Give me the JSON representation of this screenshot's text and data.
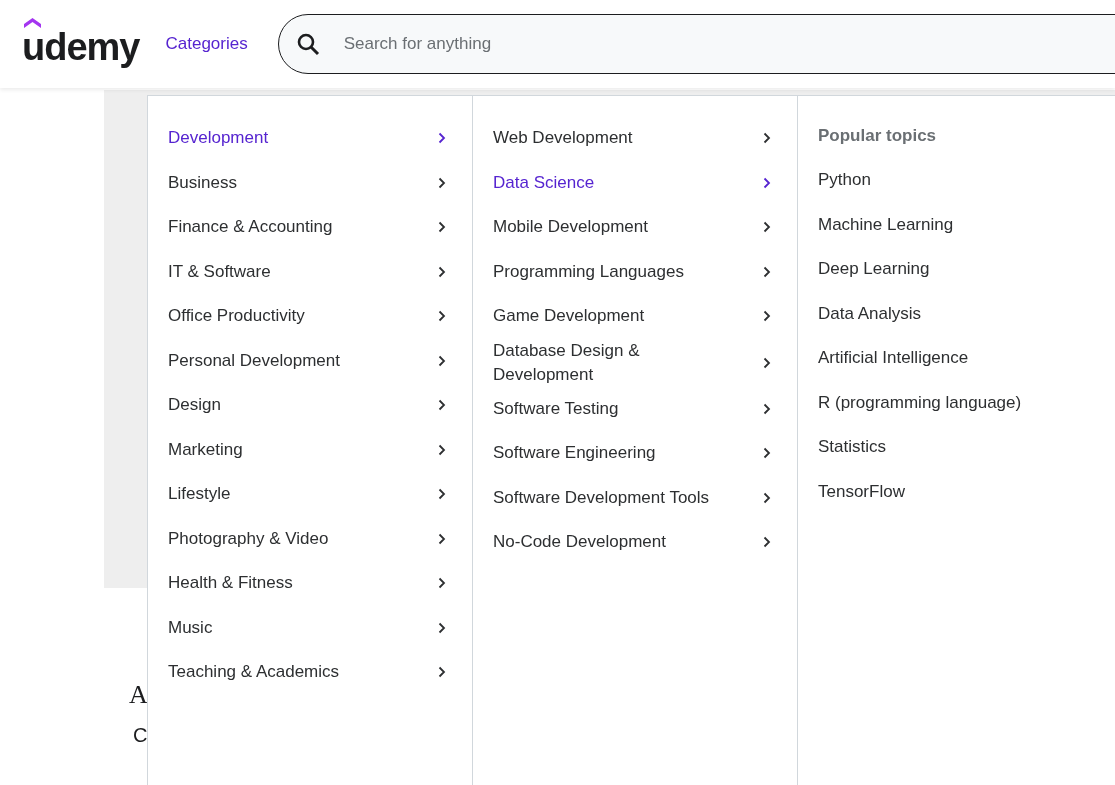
{
  "header": {
    "logo": "udemy",
    "categories_link": "Categories",
    "search": {
      "placeholder": "Search for anything"
    }
  },
  "page": {
    "heading": "A",
    "subheading": "C"
  },
  "menu": {
    "categories": [
      {
        "label": "Development",
        "selected": true
      },
      {
        "label": "Business",
        "selected": false
      },
      {
        "label": "Finance & Accounting",
        "selected": false
      },
      {
        "label": "IT & Software",
        "selected": false
      },
      {
        "label": "Office Productivity",
        "selected": false
      },
      {
        "label": "Personal Development",
        "selected": false
      },
      {
        "label": "Design",
        "selected": false
      },
      {
        "label": "Marketing",
        "selected": false
      },
      {
        "label": "Lifestyle",
        "selected": false
      },
      {
        "label": "Photography & Video",
        "selected": false
      },
      {
        "label": "Health & Fitness",
        "selected": false
      },
      {
        "label": "Music",
        "selected": false
      },
      {
        "label": "Teaching & Academics",
        "selected": false
      }
    ],
    "subcategories": [
      {
        "label": "Web Development",
        "selected": false
      },
      {
        "label": "Data Science",
        "selected": true
      },
      {
        "label": "Mobile Development",
        "selected": false
      },
      {
        "label": "Programming Languages",
        "selected": false
      },
      {
        "label": "Game Development",
        "selected": false
      },
      {
        "label": "Database Design & Development",
        "selected": false
      },
      {
        "label": "Software Testing",
        "selected": false
      },
      {
        "label": "Software Engineering",
        "selected": false
      },
      {
        "label": "Software Development Tools",
        "selected": false
      },
      {
        "label": "No-Code Development",
        "selected": false
      }
    ],
    "popular_topics": {
      "title": "Popular topics",
      "items": [
        "Python",
        "Machine Learning",
        "Deep Learning",
        "Data Analysis",
        "Artificial Intelligence",
        "R (programming language)",
        "Statistics",
        "TensorFlow"
      ]
    }
  }
}
